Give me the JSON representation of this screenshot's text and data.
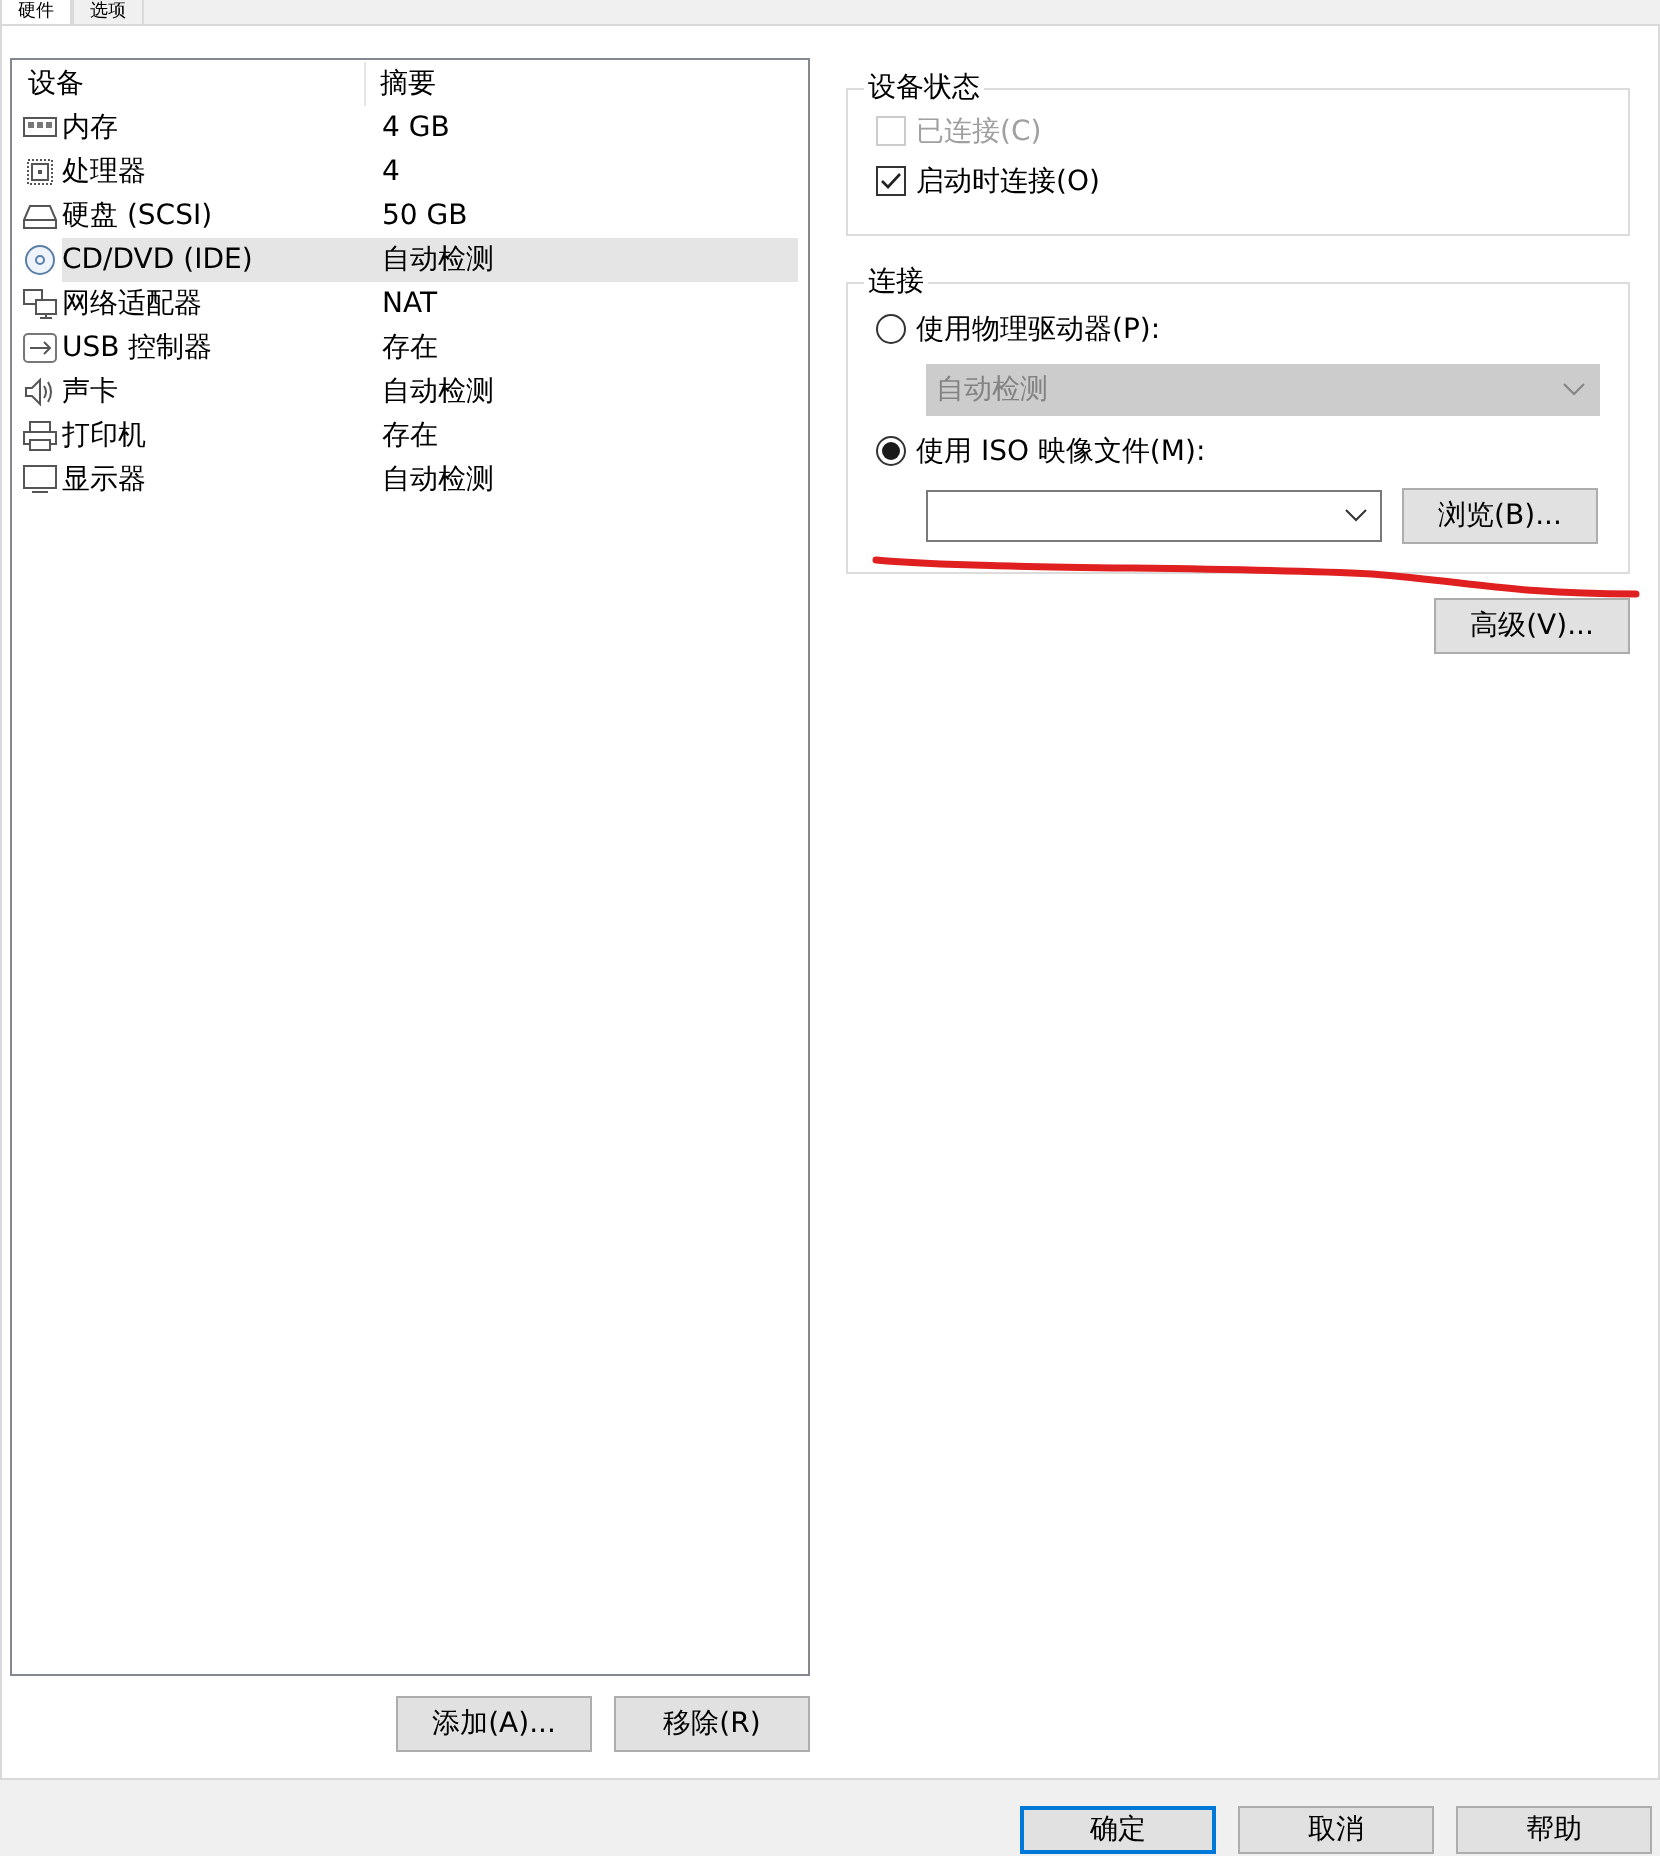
{
  "tabs": [
    {
      "label": "硬件",
      "selected": true
    },
    {
      "label": "选项",
      "selected": false
    }
  ],
  "device_list": {
    "columns": [
      "设备",
      "摘要"
    ],
    "rows": [
      {
        "kind": "memory",
        "device": "内存",
        "summary": "4 GB",
        "selected": false
      },
      {
        "kind": "cpu",
        "device": "处理器",
        "summary": "4",
        "selected": false
      },
      {
        "kind": "disk",
        "device": "硬盘 (SCSI)",
        "summary": "50 GB",
        "selected": false
      },
      {
        "kind": "cd",
        "device": "CD/DVD (IDE)",
        "summary": "自动检测",
        "selected": true
      },
      {
        "kind": "network",
        "device": "网络适配器",
        "summary": "NAT",
        "selected": false
      },
      {
        "kind": "usb",
        "device": "USB 控制器",
        "summary": "存在",
        "selected": false
      },
      {
        "kind": "sound",
        "device": "声卡",
        "summary": "自动检测",
        "selected": false
      },
      {
        "kind": "printer",
        "device": "打印机",
        "summary": "存在",
        "selected": false
      },
      {
        "kind": "display",
        "device": "显示器",
        "summary": "自动检测",
        "selected": false
      }
    ]
  },
  "list_buttons": [
    "添加(A)...",
    "移除(R)"
  ],
  "device_status": {
    "title": "设备状态",
    "options": [
      {
        "label": "已连接(C)",
        "checked": false,
        "disabled": true
      },
      {
        "label": "启动时连接(O)",
        "checked": true,
        "disabled": false
      }
    ]
  },
  "connection": {
    "title": "连接",
    "physical": {
      "label": "使用物理驱动器(P):",
      "selected": false,
      "value": "自动检测",
      "disabled": true
    },
    "iso": {
      "label": "使用 ISO 映像文件(M):",
      "selected": true
    },
    "browse": "浏览(B)..."
  },
  "advanced": "高级(V)...",
  "buttons": [
    {
      "label": "确定",
      "default": true
    },
    {
      "label": "取消",
      "default": false
    },
    {
      "label": "帮助",
      "default": false
    }
  ]
}
